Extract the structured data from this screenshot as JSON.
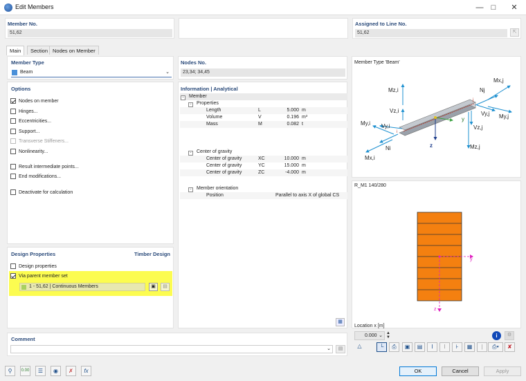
{
  "window": {
    "title": "Edit Members"
  },
  "member_no": {
    "label": "Member No.",
    "value": "51,62"
  },
  "assigned_line": {
    "label": "Assigned to Line No.",
    "value": "51,62"
  },
  "tabs": [
    {
      "label": "Main"
    },
    {
      "label": "Section"
    },
    {
      "label": "Nodes on Member"
    }
  ],
  "member_type": {
    "label": "Member Type",
    "value": "Beam",
    "color": "#4a90d9"
  },
  "nodes_no": {
    "label": "Nodes No.",
    "value": "23,34; 34,45"
  },
  "options": {
    "label": "Options",
    "items": [
      {
        "label": "Nodes on member",
        "checked": true,
        "disabled": false
      },
      {
        "label": "Hinges...",
        "checked": false,
        "disabled": false
      },
      {
        "label": "Eccentricities...",
        "checked": false,
        "disabled": false
      },
      {
        "label": "Support...",
        "checked": false,
        "disabled": false
      },
      {
        "label": "Transverse Stiffeners...",
        "checked": false,
        "disabled": true
      },
      {
        "label": "Nonlinearity...",
        "checked": false,
        "disabled": false
      },
      {
        "label": "Result intermediate points...",
        "checked": false,
        "disabled": false
      },
      {
        "label": "End modifications...",
        "checked": false,
        "disabled": false
      },
      {
        "label": "Deactivate for calculation",
        "checked": false,
        "disabled": false
      }
    ]
  },
  "info": {
    "label": "Information | Analytical",
    "member": "Member",
    "properties": "Properties",
    "props": [
      {
        "name": "Length",
        "sym": "L",
        "val": "5.000",
        "unit": "m"
      },
      {
        "name": "Volume",
        "sym": "V",
        "val": "0.196",
        "unit": "m³"
      },
      {
        "name": "Mass",
        "sym": "M",
        "val": "0.082",
        "unit": "t"
      }
    ],
    "cog": "Center of gravity",
    "cog_rows": [
      {
        "name": "Center of gravity",
        "sym": "XC",
        "val": "10.000",
        "unit": "m"
      },
      {
        "name": "Center of gravity",
        "sym": "YC",
        "val": "15.000",
        "unit": "m"
      },
      {
        "name": "Center of gravity",
        "sym": "ZC",
        "val": "-4.000",
        "unit": "m"
      }
    ],
    "orient": "Member orientation",
    "orient_rows": [
      {
        "name": "Position",
        "val": "Parallel to axis X of global CS"
      }
    ]
  },
  "design": {
    "label": "Design Properties",
    "right": "Timber Design",
    "design_props": "Design properties",
    "via_parent": "Via parent member set",
    "set_value": "1 - 51,62 | Continuous Members",
    "highlight": "#fcfc50"
  },
  "diagram": {
    "title": "Member Type 'Beam'",
    "labels": {
      "mzi": "Mz,i",
      "mxj": "Mx,j",
      "nj": "Nj",
      "vzi": "Vz,i",
      "vyj": "Vy,j",
      "myj": "My,j",
      "myi": "My,i",
      "vyi": "Vy,i",
      "y": "y",
      "vzj": "Vz,j",
      "z": "z",
      "ni": "Ni",
      "mzj": "Mz,j",
      "mxi": "Mx,i",
      "i": "i",
      "j": "j"
    },
    "arrow_color": "#1e90d0"
  },
  "section": {
    "title": "R_M1 140/280",
    "fill": "#f48010",
    "axis_y": "y",
    "axis_z": "z"
  },
  "location": {
    "label": "Location x [m]",
    "value": "0.000"
  },
  "comment": {
    "label": "Comment",
    "value": ""
  },
  "buttons": {
    "ok": "OK",
    "cancel": "Cancel",
    "apply": "Apply"
  }
}
